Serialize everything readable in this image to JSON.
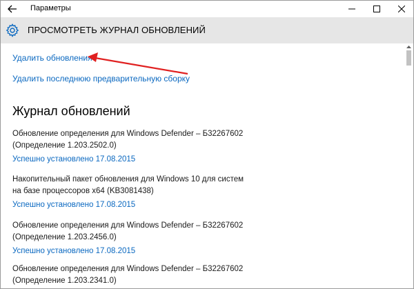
{
  "window": {
    "title": "Параметры"
  },
  "header": {
    "title": "ПРОСМОТРЕТЬ ЖУРНАЛ ОБНОВЛЕНИЙ",
    "icon": "gear-icon"
  },
  "links": {
    "uninstall_updates": "Удалить обновления",
    "uninstall_preview_build": "Удалить последнюю предварительную сборку"
  },
  "history": {
    "heading": "Журнал обновлений",
    "entries": [
      {
        "title_line1": "Обновление определения для Windows Defender – Б32267602",
        "title_line2": "(Определение 1.203.2502.0)",
        "status": "Успешно установлено 17.08.2015"
      },
      {
        "title_line1": "Накопительный пакет обновления для Windows 10 для систем",
        "title_line2": "на базе процессоров x64 (KB3081438)",
        "status": "Успешно установлено 17.08.2015"
      },
      {
        "title_line1": "Обновление определения для Windows Defender – Б32267602",
        "title_line2": "(Определение 1.203.2456.0)",
        "status": "Успешно установлено 17.08.2015"
      },
      {
        "title_line1": "Обновление определения для Windows Defender – Б32267602",
        "title_line2": "(Определение 1.203.2341.0)",
        "status": ""
      }
    ]
  },
  "colors": {
    "link": "#0a68c0",
    "header_bg": "#e6e6e6",
    "annotation_arrow": "#e02020"
  }
}
